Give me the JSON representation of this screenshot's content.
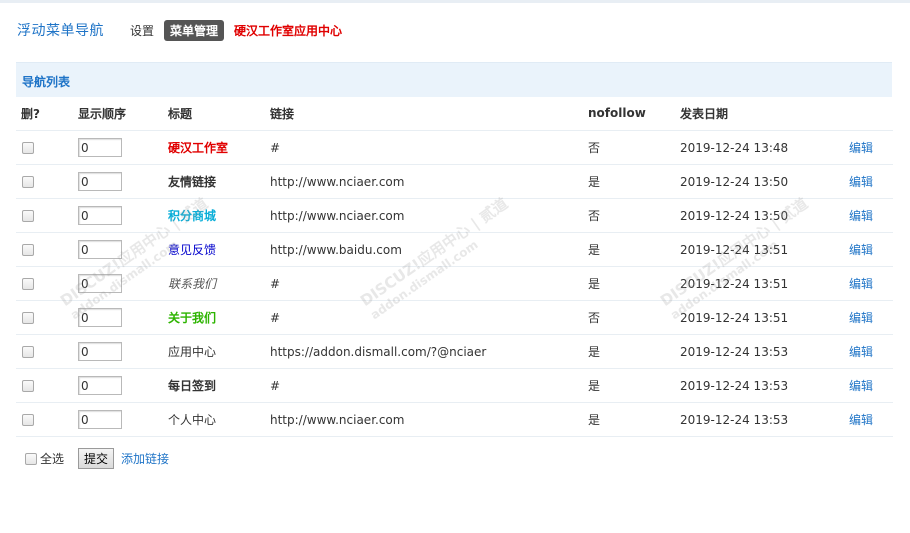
{
  "header": {
    "plugin_title": "浮动菜单导航",
    "nav_settings": "设置",
    "nav_menu_manage": "菜单管理",
    "nav_app_center": "硬汉工作室应用中心"
  },
  "section": {
    "title": "导航列表"
  },
  "columns": {
    "delete": "删?",
    "order": "显示顺序",
    "title": "标题",
    "link": "链接",
    "nofollow": "nofollow",
    "date": "发表日期"
  },
  "rows": [
    {
      "order": "0",
      "title": "硬汉工作室",
      "link": "#",
      "nofollow": "否",
      "date": "2019-12-24 13:48",
      "edit": "编辑",
      "title_color": "#e00000"
    },
    {
      "order": "0",
      "title": "友情链接",
      "link": "http://www.nciaer.com",
      "nofollow": "是",
      "date": "2019-12-24 13:50",
      "edit": "编辑",
      "title_color": "#333333"
    },
    {
      "order": "0",
      "title": "积分商城",
      "link": "http://www.nciaer.com",
      "nofollow": "否",
      "date": "2019-12-24 13:50",
      "edit": "编辑",
      "title_color": "#0aaed8"
    },
    {
      "order": "0",
      "title": "意见反馈",
      "link": "http://www.baidu.com",
      "nofollow": "是",
      "date": "2019-12-24 13:51",
      "edit": "编辑",
      "title_color": "#0000cc"
    },
    {
      "order": "0",
      "title": "联系我们",
      "link": "#",
      "nofollow": "是",
      "date": "2019-12-24 13:51",
      "edit": "编辑",
      "title_color": "#555555"
    },
    {
      "order": "0",
      "title": "关于我们",
      "link": "#",
      "nofollow": "否",
      "date": "2019-12-24 13:51",
      "edit": "编辑",
      "title_color": "#2db400"
    },
    {
      "order": "0",
      "title": "应用中心",
      "link": "https://addon.dismall.com/?@nciaer",
      "nofollow": "是",
      "date": "2019-12-24 13:53",
      "edit": "编辑",
      "title_color": "#333333"
    },
    {
      "order": "0",
      "title": "每日签到",
      "link": "#",
      "nofollow": "是",
      "date": "2019-12-24 13:53",
      "edit": "编辑",
      "title_color": "#333333"
    },
    {
      "order": "0",
      "title": "个人中心",
      "link": "http://www.nciaer.com",
      "nofollow": "是",
      "date": "2019-12-24 13:53",
      "edit": "编辑",
      "title_color": "#333333"
    }
  ],
  "footer": {
    "select_all": "全选",
    "submit": "提交",
    "add_link": "添加链接"
  },
  "watermark": {
    "text1": "DISCUZ!应用中心 | 贰道",
    "text2": "addon.dismall.com"
  }
}
